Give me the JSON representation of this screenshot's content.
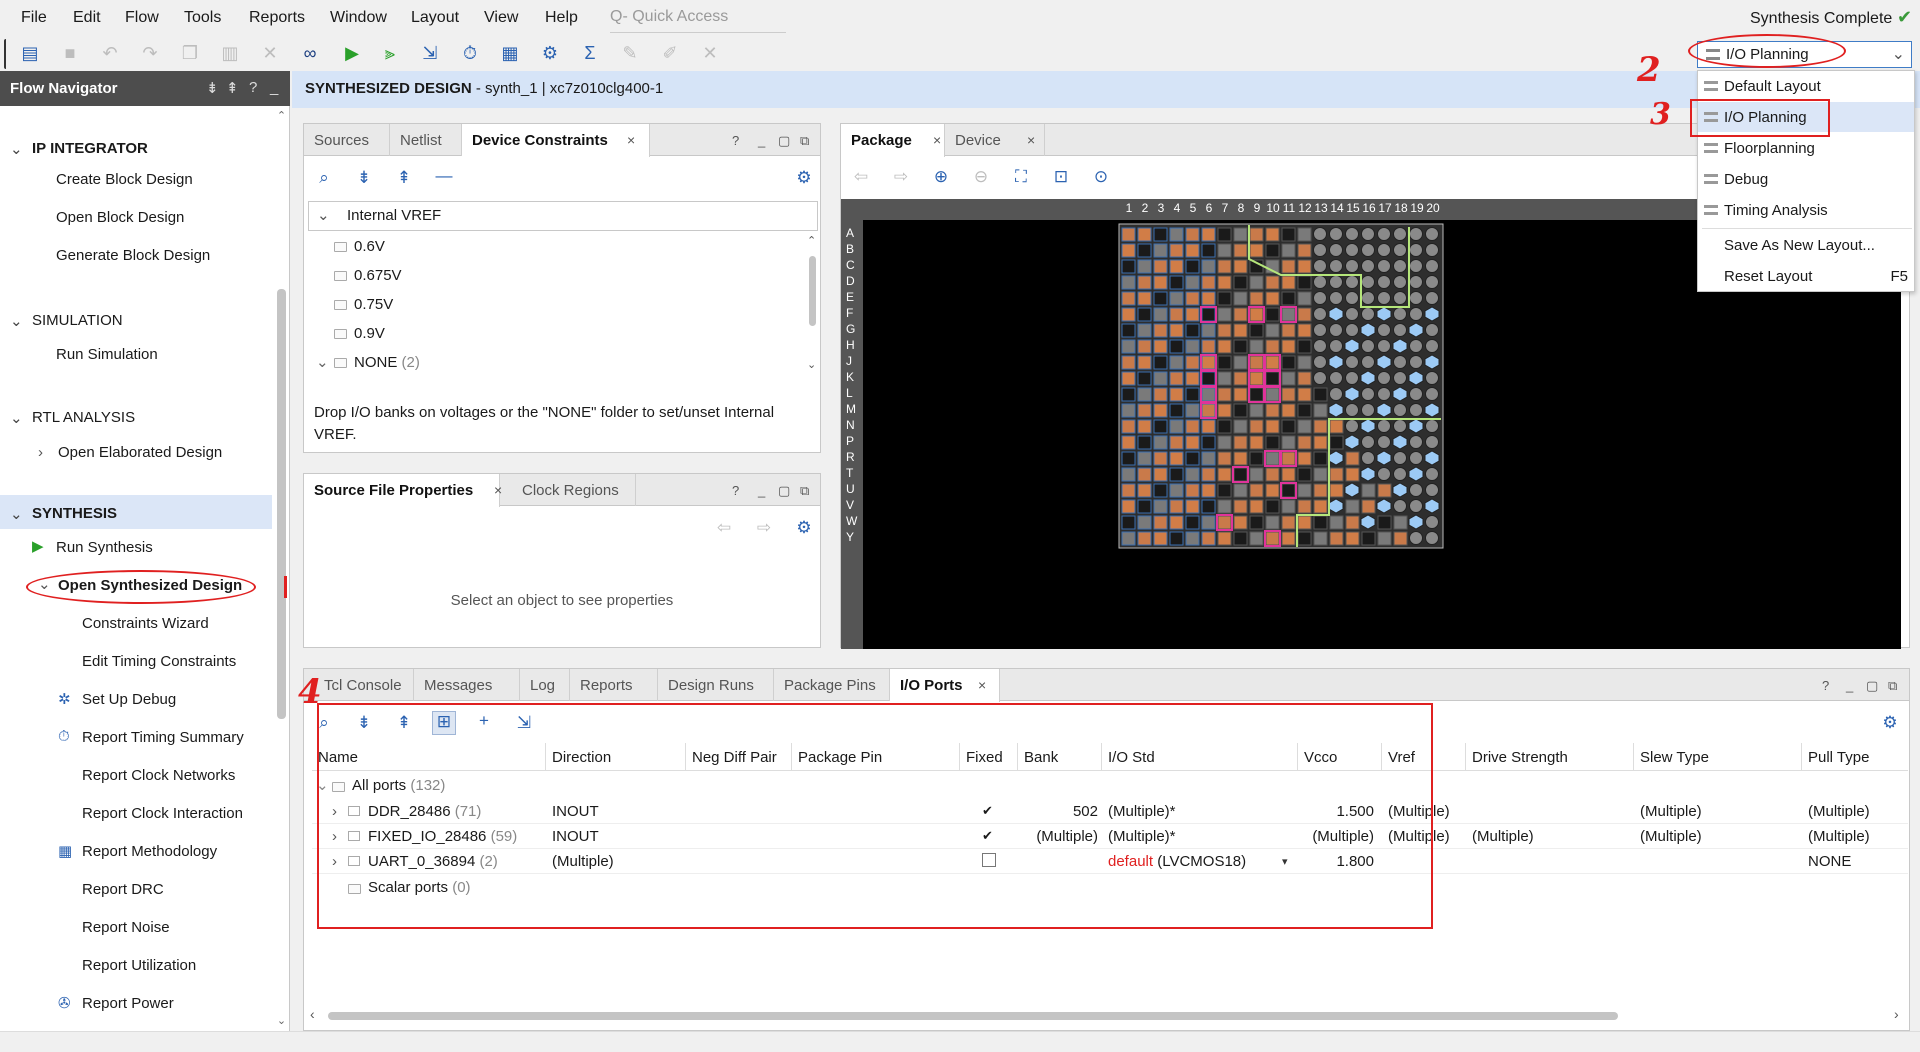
{
  "menubar": {
    "items": [
      "File",
      "Edit",
      "Flow",
      "Tools",
      "Reports",
      "Window",
      "Layout",
      "View",
      "Help"
    ],
    "quick_access_placeholder": "Q- Quick Access",
    "status": "Synthesis Complete"
  },
  "layout_selector": {
    "selected": "I/O Planning",
    "options": [
      {
        "label": "Default Layout",
        "shortcut": ""
      },
      {
        "label": "I/O Planning",
        "shortcut": ""
      },
      {
        "label": "Floorplanning",
        "shortcut": ""
      },
      {
        "label": "Debug",
        "shortcut": ""
      },
      {
        "label": "Timing Analysis",
        "shortcut": ""
      },
      {
        "label": "Save As New Layout...",
        "shortcut": ""
      },
      {
        "label": "Reset Layout",
        "shortcut": "F5"
      }
    ]
  },
  "flow_navigator": {
    "title": "Flow Navigator",
    "sections": {
      "ip_integrator": {
        "title": "IP INTEGRATOR",
        "items": [
          "Create Block Design",
          "Open Block Design",
          "Generate Block Design"
        ]
      },
      "simulation": {
        "title": "SIMULATION",
        "items": [
          "Run Simulation"
        ]
      },
      "rtl_analysis": {
        "title": "RTL ANALYSIS",
        "items": [
          "Open Elaborated Design"
        ]
      },
      "synthesis": {
        "title": "SYNTHESIS",
        "items": [
          "Run Synthesis",
          "Open Synthesized Design",
          "Constraints Wizard",
          "Edit Timing Constraints",
          "Set Up Debug",
          "Report Timing Summary",
          "Report Clock Networks",
          "Report Clock Interaction",
          "Report Methodology",
          "Report DRC",
          "Report Noise",
          "Report Utilization",
          "Report Power"
        ]
      }
    }
  },
  "design_header": {
    "title": "SYNTHESIZED DESIGN",
    "subtitle": " - synth_1 | xc7z010clg400-1"
  },
  "device_constraints": {
    "tabs": [
      "Sources",
      "Netlist",
      "Device Constraints"
    ],
    "root": "Internal VREF",
    "children": [
      "0.6V",
      "0.675V",
      "0.75V",
      "0.9V"
    ],
    "none_label": "NONE",
    "none_count": "(2)",
    "help": "Drop I/O banks on voltages or the \"NONE\" folder to set/unset Internal VREF."
  },
  "source_props": {
    "tabs": [
      "Source File Properties",
      "Clock Regions"
    ],
    "empty": "Select an object to see properties"
  },
  "package_panel": {
    "tabs": [
      "Package",
      "Device"
    ],
    "columns": [
      "1",
      "2",
      "3",
      "4",
      "5",
      "6",
      "7",
      "8",
      "9",
      "10",
      "11",
      "12",
      "13",
      "14",
      "15",
      "16",
      "17",
      "18",
      "19",
      "20"
    ],
    "rows": [
      "A",
      "B",
      "C",
      "D",
      "E",
      "F",
      "G",
      "H",
      "J",
      "K",
      "L",
      "M",
      "N",
      "P",
      "R",
      "T",
      "U",
      "V",
      "W",
      "Y"
    ]
  },
  "bottom_panel": {
    "tabs": [
      "Tcl Console",
      "Messages",
      "Log",
      "Reports",
      "Design Runs",
      "Package Pins",
      "I/O Ports"
    ],
    "columns": [
      "Name",
      "Direction",
      "Neg Diff Pair",
      "Package Pin",
      "Fixed",
      "Bank",
      "I/O Std",
      "Vcco",
      "Vref",
      "Drive Strength",
      "Slew Type",
      "Pull Type"
    ],
    "all_ports": {
      "label": "All ports",
      "count": "(132)"
    },
    "rows": [
      {
        "name": "DDR_28486",
        "count": "(71)",
        "direction": "INOUT",
        "fixed": "✔",
        "bank": "502",
        "iostd": "(Multiple)*",
        "iostd_default": "",
        "vcco": "1.500",
        "vref": "(Multiple)",
        "drive": "",
        "slew": "(Multiple)",
        "pull": "(Multiple)"
      },
      {
        "name": "FIXED_IO_28486",
        "count": "(59)",
        "direction": "INOUT",
        "fixed": "✔",
        "bank": "(Multiple)",
        "iostd": "(Multiple)*",
        "iostd_default": "",
        "vcco": "(Multiple)",
        "vref": "(Multiple)",
        "drive": "(Multiple)",
        "slew": "(Multiple)",
        "pull": "(Multiple)"
      },
      {
        "name": "UART_0_36894",
        "count": "(2)",
        "direction": "(Multiple)",
        "fixed": "",
        "bank": "",
        "iostd": "(LVCMOS18)",
        "iostd_default": "default",
        "vcco": "1.800",
        "vref": "",
        "drive": "",
        "slew": "",
        "pull": "NONE"
      }
    ],
    "scalar_ports": {
      "label": "Scalar ports",
      "count": "(0)"
    }
  },
  "annotations": {
    "n2": "2",
    "n3": "3",
    "n4": "4"
  },
  "icons": {
    "toolbar": [
      "open-project-icon",
      "save-icon",
      "undo-icon",
      "redo-icon",
      "copy-icon",
      "paste-icon",
      "delete-icon",
      "binoculars-icon",
      "run-icon",
      "step-icon",
      "export-icon",
      "timer-icon",
      "report-icon",
      "gear-icon",
      "sigma-icon"
    ]
  }
}
